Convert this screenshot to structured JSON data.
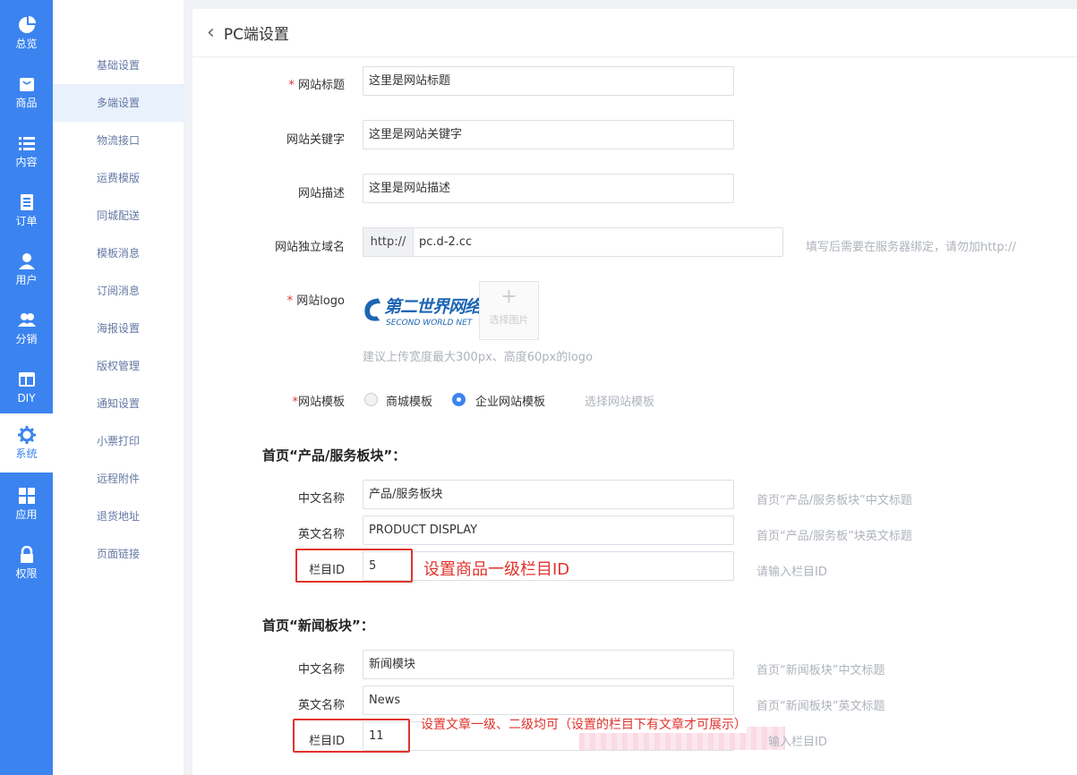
{
  "nav": [
    {
      "label": "总览",
      "icon": "pie-chart-icon"
    },
    {
      "label": "商品",
      "icon": "bag-icon"
    },
    {
      "label": "内容",
      "icon": "list-icon"
    },
    {
      "label": "订单",
      "icon": "order-icon"
    },
    {
      "label": "用户",
      "icon": "user-icon"
    },
    {
      "label": "分销",
      "icon": "users-icon"
    },
    {
      "label": "DIY",
      "icon": "layout-icon"
    },
    {
      "label": "系统",
      "icon": "gear-icon"
    },
    {
      "label": "应用",
      "icon": "grid-icon"
    },
    {
      "label": "权限",
      "icon": "lock-icon"
    }
  ],
  "submenu": [
    "基础设置",
    "多端设置",
    "物流接口",
    "运费模版",
    "同城配送",
    "模板消息",
    "订阅消息",
    "海报设置",
    "版权管理",
    "通知设置",
    "小票打印",
    "远程附件",
    "退货地址",
    "页面链接"
  ],
  "page": {
    "title": "PC端设置"
  },
  "form": {
    "site_title": {
      "label": "网站标题",
      "value": "这里是网站标题"
    },
    "keywords": {
      "label": "网站关键字",
      "value": "这里是网站关键字"
    },
    "description": {
      "label": "网站描述",
      "value": "这里是网站描述"
    },
    "domain": {
      "label": "网站独立域名",
      "prefix": "http://",
      "value": "pc.d-2.cc",
      "hint": "填写后需要在服务器绑定，请勿加http://"
    },
    "logo": {
      "label": "网站logo",
      "logo_cn": "第二世界网络",
      "logo_en": "SECOND WORLD NET",
      "upload": "选择图片",
      "hint": "建议上传宽度最大300px、高度60px的logo"
    },
    "template": {
      "label": "网站模板",
      "option1": "商城模板",
      "option2": "企业网站模板",
      "selected": "企业网站模板",
      "link": "选择网站模板"
    }
  },
  "products": {
    "section": "首页“产品/服务板块”：",
    "cn_label": "中文名称",
    "cn_value": "产品/服务板块",
    "cn_hint": "首页“产品/服务板块”中文标题",
    "en_label": "英文名称",
    "en_value": "PRODUCT DISPLAY",
    "en_hint": "首页“产品/服务板”块英文标题",
    "id_label": "栏目ID",
    "id_value": "5",
    "id_hint": "请输入栏目ID",
    "note": "设置商品一级栏目ID"
  },
  "news": {
    "section": "首页“新闻板块”：",
    "cn_label": "中文名称",
    "cn_value": "新闻模块",
    "cn_hint": "首页“新闻板块”中文标题",
    "en_label": "英文名称",
    "en_value": "News",
    "en_hint": "首页“新闻板块”英文标题",
    "id_label": "栏目ID",
    "id_value": "11",
    "id_hint": "输入栏目ID",
    "note": "设置文章一级、二级均可（设置的栏目下有文章才可展示）"
  },
  "colors": {
    "accent": "#3b84f0",
    "annotation": "#e0332d"
  }
}
